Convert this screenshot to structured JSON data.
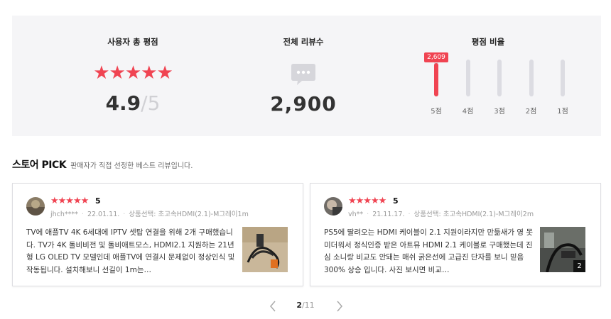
{
  "summary": {
    "rating": {
      "title": "사용자 총 평점",
      "stars": "★★★★★",
      "score": "4.9",
      "max": "/5"
    },
    "reviews": {
      "title": "전체 리뷰수",
      "count": "2,900",
      "icon": "speech-bubble-icon"
    },
    "ratio": {
      "title": "평점 비율",
      "bars": [
        {
          "label": "5점",
          "fraction": 0.9,
          "tip": "2,609"
        },
        {
          "label": "4점",
          "fraction": 0
        },
        {
          "label": "3점",
          "fraction": 0
        },
        {
          "label": "2점",
          "fraction": 0
        },
        {
          "label": "1점",
          "fraction": 0
        }
      ]
    }
  },
  "pick": {
    "title": "스토어 PICK",
    "description": "판매자가 직접 선정한 베스트 리뷰입니다."
  },
  "reviews": [
    {
      "stars": "★★★★★",
      "score": "5",
      "user": "jhch****",
      "date": "22.01.11.",
      "option": "상품선택: 초고속HDMI(2.1)-M그레이1m",
      "text": "TV에 애플TV 4K 6세대에 IPTV 셋탑 연결을 위해 2개 구매했습니다. TV가 4K 돌비비전 및 돌비애트모스, HDMI2.1 지원하는 21년형 LG OLED TV 모델인데 애플TV에 연결시 문제없이 정상인식 및 작동됩니다. 설치해보니 선길이 1m는…"
    },
    {
      "stars": "★★★★★",
      "score": "5",
      "user": "vh**",
      "date": "21.11.17.",
      "option": "상품선택: 초고속HDMI(2.1)-M그레이2m",
      "text": "PS5에 딸려오는 HDMI 케이블이 2.1 지원이라지만 만듦새가 영 못미더워서 정식인증 받은 아트뮤 HDMI 2.1 케이블로 구매했는데 진심 소니랑 비교도 안돼는 매쉬 굵은선에 고급진 단자를 보니 믿음 300% 상승 입니다. 사진 보시면 비교…",
      "photo_count": "2"
    }
  ],
  "pager": {
    "current": "2",
    "total": "/11"
  },
  "colors": {
    "accent": "#f04452",
    "panel": "#f5f5f7"
  }
}
